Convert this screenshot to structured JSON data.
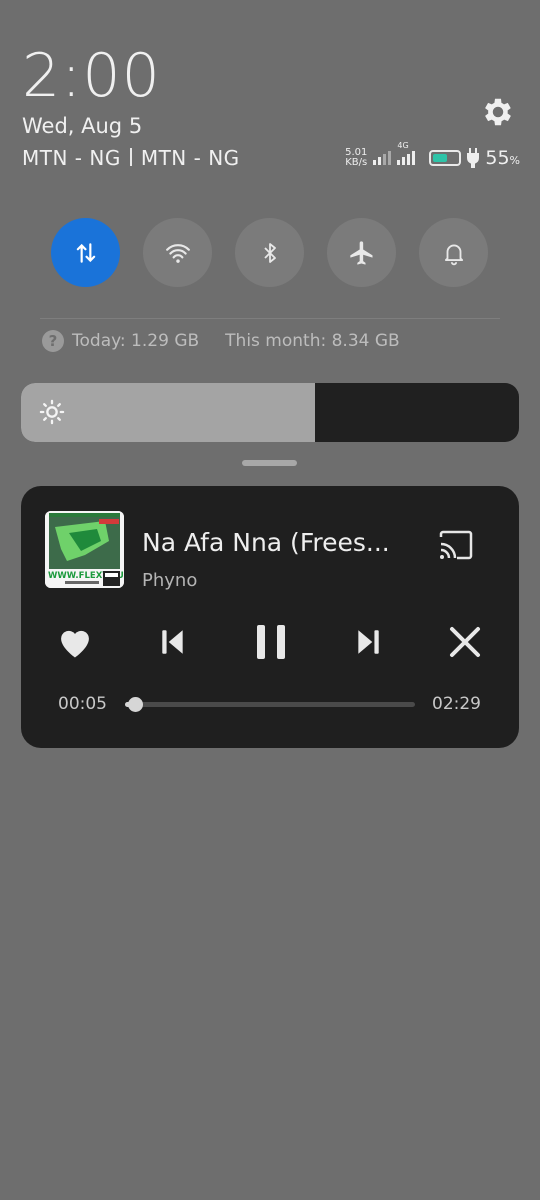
{
  "status": {
    "clock": "2:00",
    "date": "Wed, Aug 5",
    "carrier_1": "MTN - NG",
    "carrier_2": "MTN - NG",
    "net_speed_value": "5.01",
    "net_speed_unit": "KB/s",
    "network_type": "4G",
    "battery_level": 55,
    "battery_percent": "55",
    "battery_unit": "%",
    "battery_color": "#2ec4a8",
    "icons": [
      "settings-gear-icon",
      "signal-icon",
      "charging-bolt-icon",
      "battery-icon"
    ]
  },
  "quick_settings": [
    {
      "id": "mobile-data",
      "icon": "mobile-data-arrows-icon",
      "active": true
    },
    {
      "id": "wifi",
      "icon": "wifi-icon",
      "active": false
    },
    {
      "id": "bluetooth",
      "icon": "bluetooth-icon",
      "active": false
    },
    {
      "id": "airplane",
      "icon": "airplane-icon",
      "active": false
    },
    {
      "id": "sound",
      "icon": "bell-icon",
      "active": false
    }
  ],
  "accent_color": "#1a73d9",
  "data_usage": {
    "today": "Today: 1.29 GB",
    "month": "This month: 8.34 GB",
    "help_glyph": "?"
  },
  "brightness": {
    "level": 0.59,
    "icon": "sun-icon"
  },
  "media": {
    "title": "Na Afa Nna (Frees...",
    "artist": "Phyno",
    "elapsed": "00:05",
    "total": "02:29",
    "progress": 0.034,
    "album_art_text": "WWW.FLEXYMUSIC",
    "controls": [
      "heart-icon",
      "previous-icon",
      "pause-icon",
      "next-icon",
      "close-icon"
    ],
    "cast_icon": "cast-icon"
  }
}
